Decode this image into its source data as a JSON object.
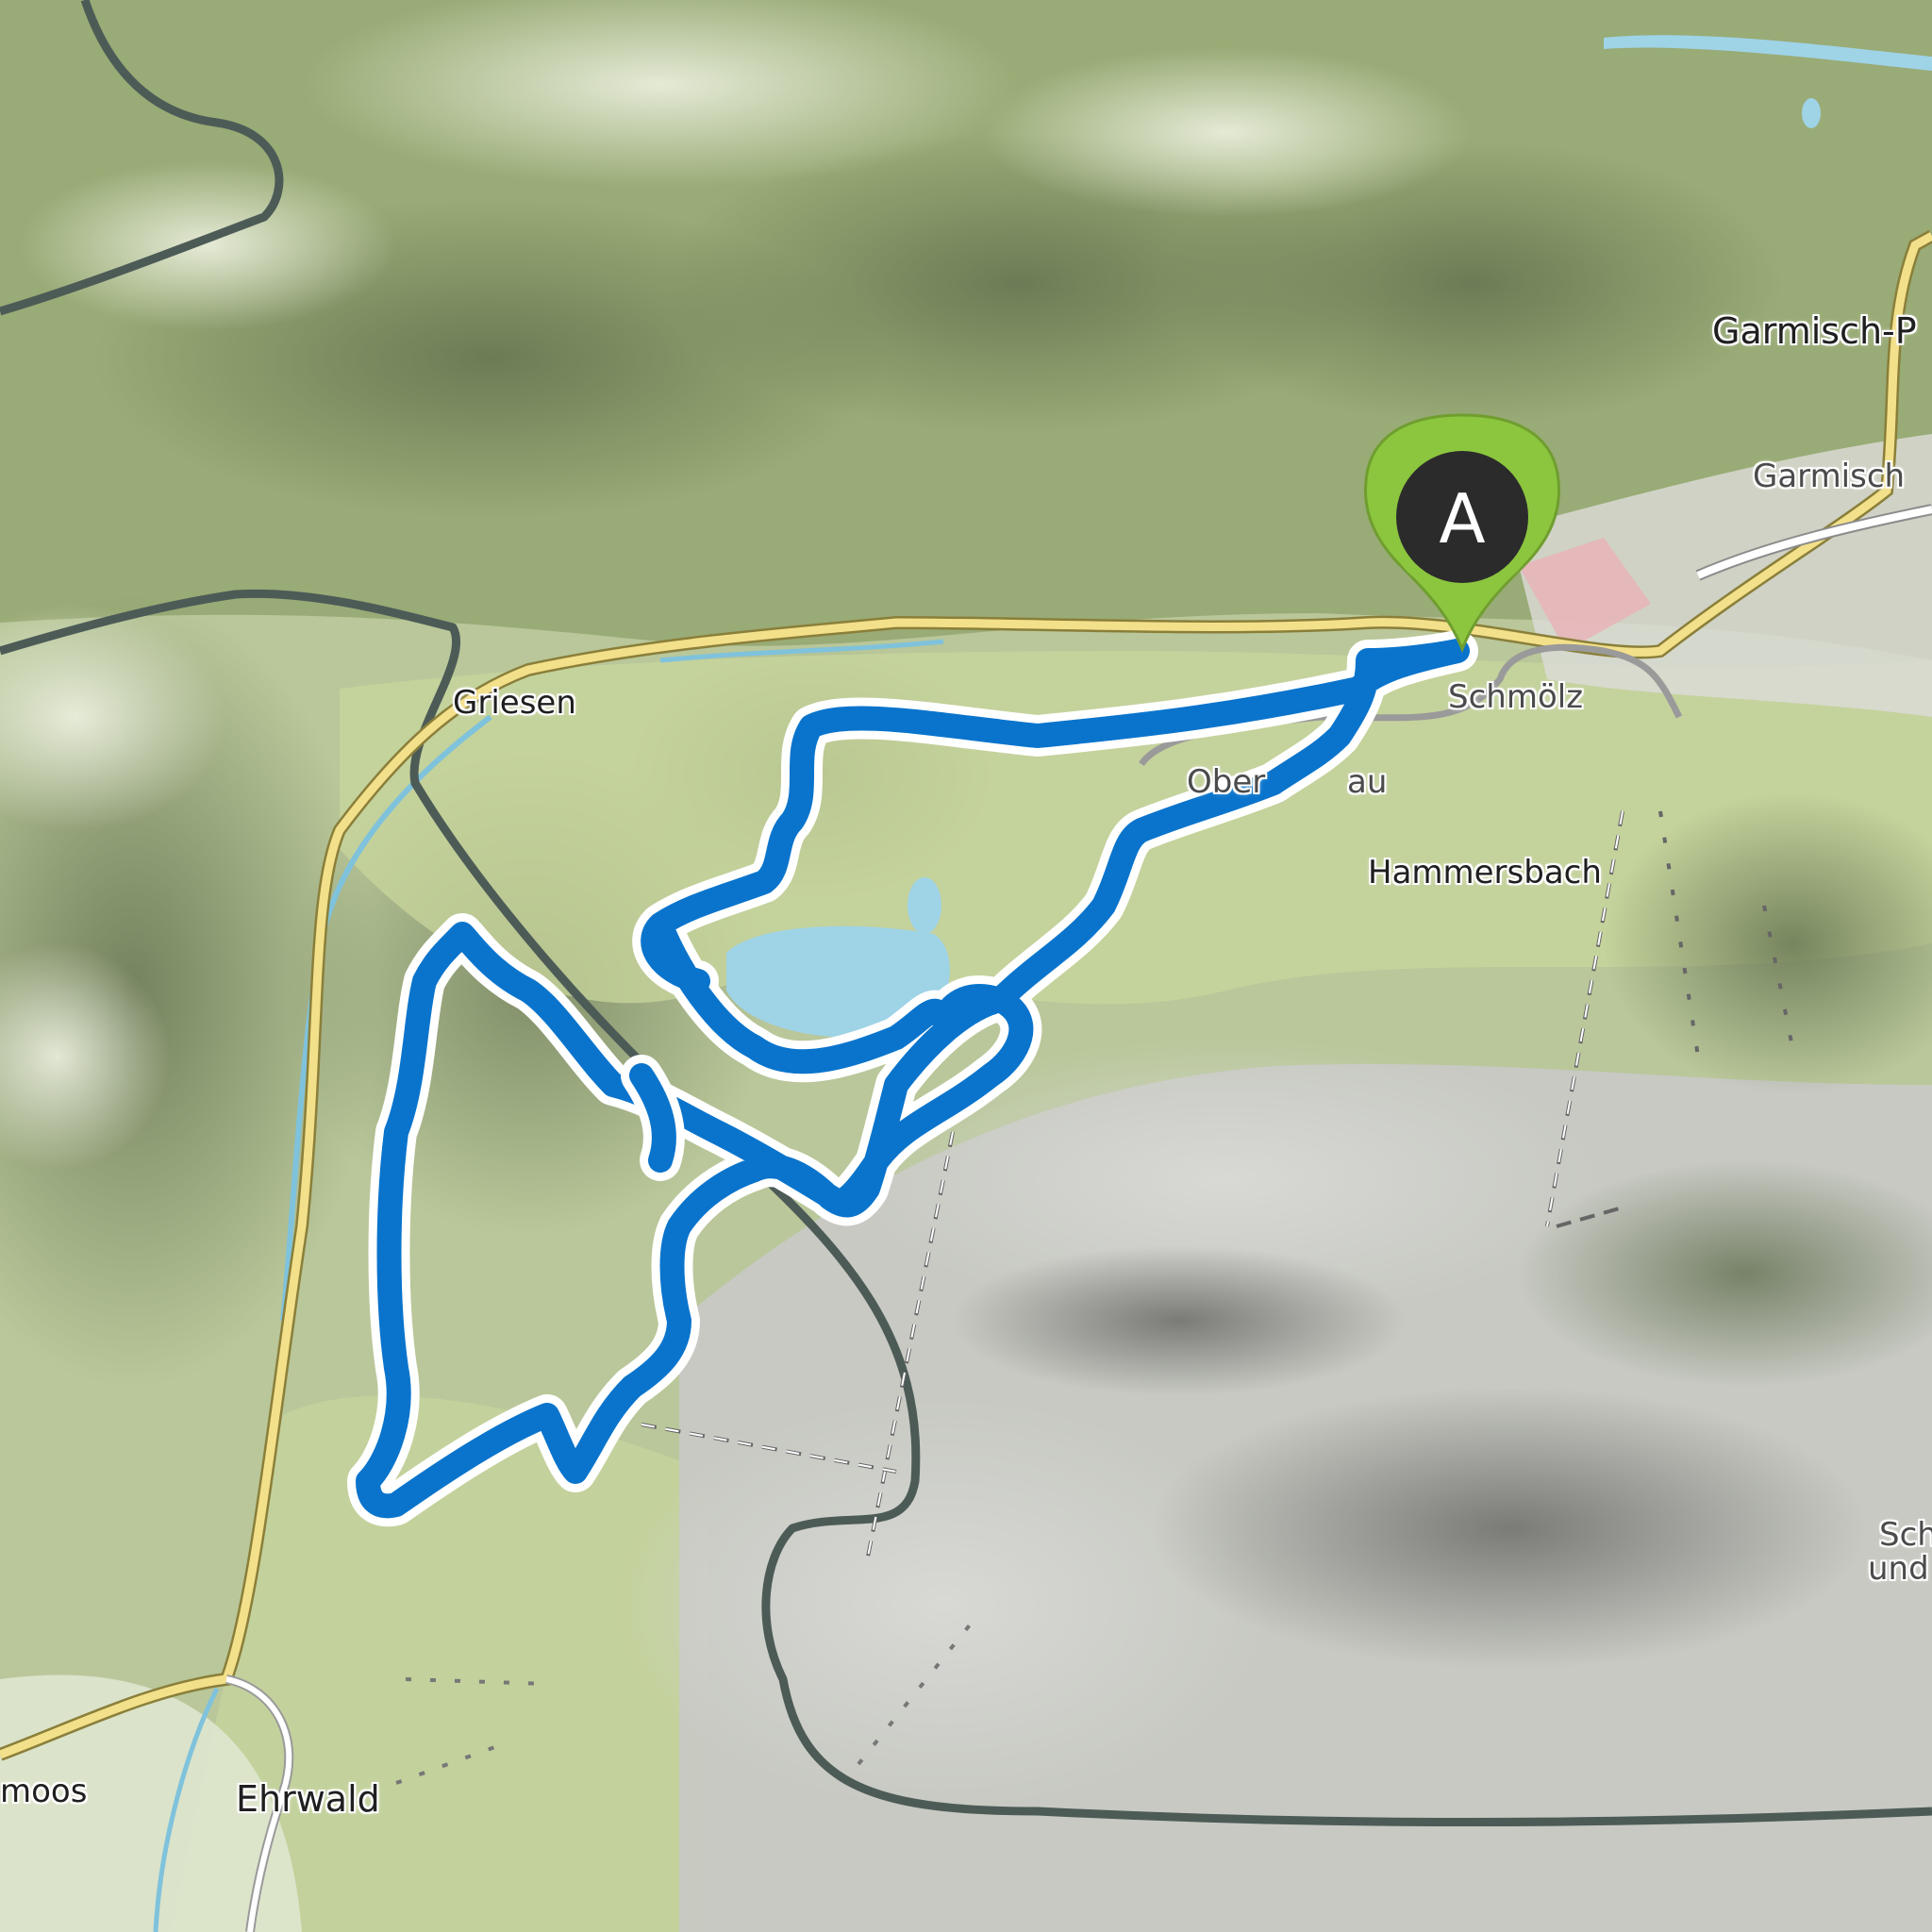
{
  "map": {
    "places": {
      "garmisch_p": "Garmisch-P",
      "garmisch": "Garmisch",
      "griesen": "Griesen",
      "schmoelz": "Schmölz",
      "oberg_au": "Ober",
      "oberg_au_tail": "au",
      "hammersbach": "Hammersbach",
      "ehrwald": "Ehrwald",
      "lermoos": "moos",
      "sch": "Sch",
      "und": "und"
    },
    "start_marker": {
      "label": "A",
      "color": "#8cc63f"
    },
    "route": {
      "color": "#0a74cc",
      "outline": "#ffffff"
    },
    "colors": {
      "border": "#4d5b57",
      "main_road": "#f3e08a",
      "lake": "#9fd3e6",
      "rock": "#c9c9c9",
      "forest": "#8ea36b",
      "meadow": "#c8d69c"
    }
  }
}
